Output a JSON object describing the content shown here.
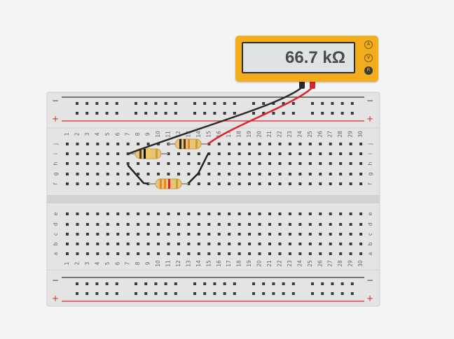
{
  "multimeter": {
    "reading": "66.7 kΩ",
    "modes": [
      {
        "label": "A",
        "active": false
      },
      {
        "label": "V",
        "active": false
      },
      {
        "label": "R",
        "active": true
      }
    ]
  },
  "breadboard": {
    "columns": [
      "1",
      "2",
      "3",
      "4",
      "5",
      "6",
      "7",
      "8",
      "9",
      "10",
      "11",
      "12",
      "13",
      "14",
      "15",
      "16",
      "17",
      "18",
      "19",
      "20",
      "21",
      "22",
      "23",
      "24",
      "25",
      "26",
      "27",
      "28",
      "29",
      "30"
    ],
    "rows_top": [
      "j",
      "i",
      "h",
      "g",
      "f"
    ],
    "rows_bottom": [
      "e",
      "d",
      "c",
      "b",
      "a"
    ],
    "rail_minus": "−",
    "rail_plus": "+"
  },
  "colors": {
    "probe_black": "#2b2b2b",
    "probe_red": "#d7262c",
    "wire": "#222222",
    "resistor_body": "#e8c47a",
    "meter_body": "#f2ac1c"
  }
}
